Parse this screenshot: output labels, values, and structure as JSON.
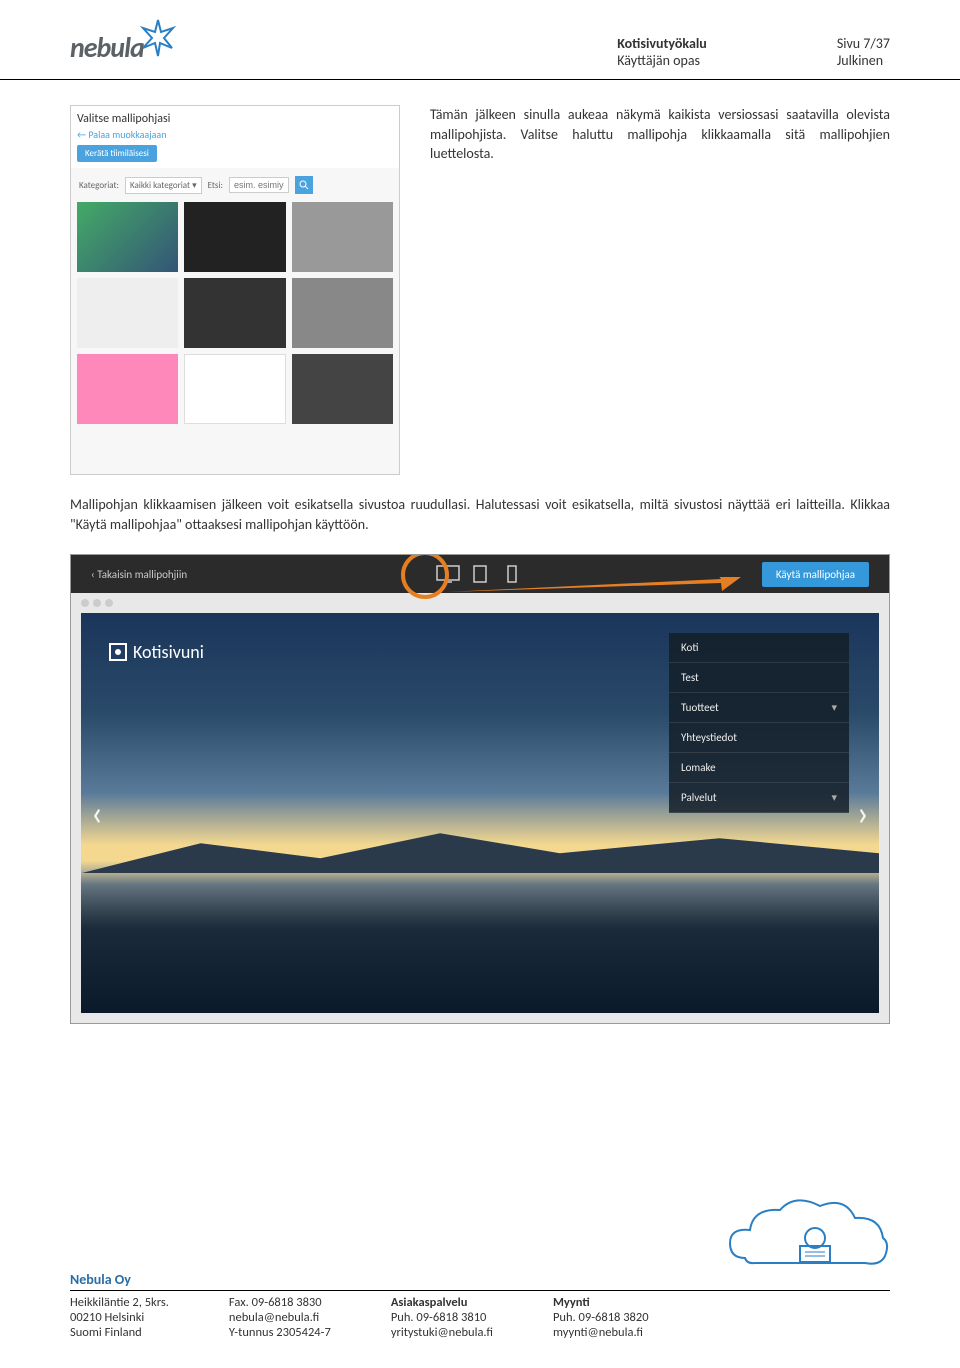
{
  "header": {
    "logo_text": "nebula",
    "doc_title": "Kotisivutyökalu",
    "doc_subtitle": "Käyttäjän opas",
    "page_info": "Sivu 7/37",
    "visibility": "Julkinen"
  },
  "screenshot_a": {
    "title": "Valitse mallipohjasi",
    "back_link": "Palaa muokkaajaan",
    "button": "Kerätä tiimiläisesi",
    "category_label": "Kategoriat:",
    "category_value": "Kaikki kategoriat",
    "filter_label": "Etsi:",
    "filter_placeholder": "esim. esimiyö"
  },
  "paragraph1": "Tämän jälkeen sinulla aukeaa näkymä kaikista versiossasi saatavilla olevista mallipohjista. Valitse haluttu mallipohja klikkaamalla sitä mallipohjien luettelosta.",
  "paragraph2": "Mallipohjan klikkaamisen jälkeen voit esikatsella sivustoa ruudullasi. Halutessasi voit esikatsella, miltä sivustosi näyttää eri laitteilla. Klikkaa \"Käytä mallipohjaa\" ottaaksesi mallipohjan käyttöön.",
  "screenshot_b": {
    "back": "Takaisin mallipohjiin",
    "use_button": "Käytä mallipohjaa",
    "site_name": "Kotisivuni",
    "menu": [
      "Koti",
      "Test",
      "Tuotteet",
      "Yhteystiedot",
      "Lomake",
      "Palvelut"
    ],
    "menu_has_sub": [
      false,
      false,
      true,
      false,
      false,
      true
    ]
  },
  "footer": {
    "company": "Nebula Oy",
    "col1": {
      "l1": "Heikkiläntie 2, 5krs.",
      "l2": "00210 Helsinki",
      "l3": "Suomi Finland"
    },
    "col2": {
      "l1": "Fax. 09-6818 3830",
      "l2": "nebula@nebula.fi",
      "l3": "Y-tunnus 2305424-7"
    },
    "col3": {
      "h": "Asiakaspalvelu",
      "l1": "Puh. 09-6818 3810",
      "l2": "yritystuki@nebula.fi"
    },
    "col4": {
      "h": "Myynti",
      "l1": "Puh. 09-6818 3820",
      "l2": "myynti@nebula.fi"
    }
  }
}
